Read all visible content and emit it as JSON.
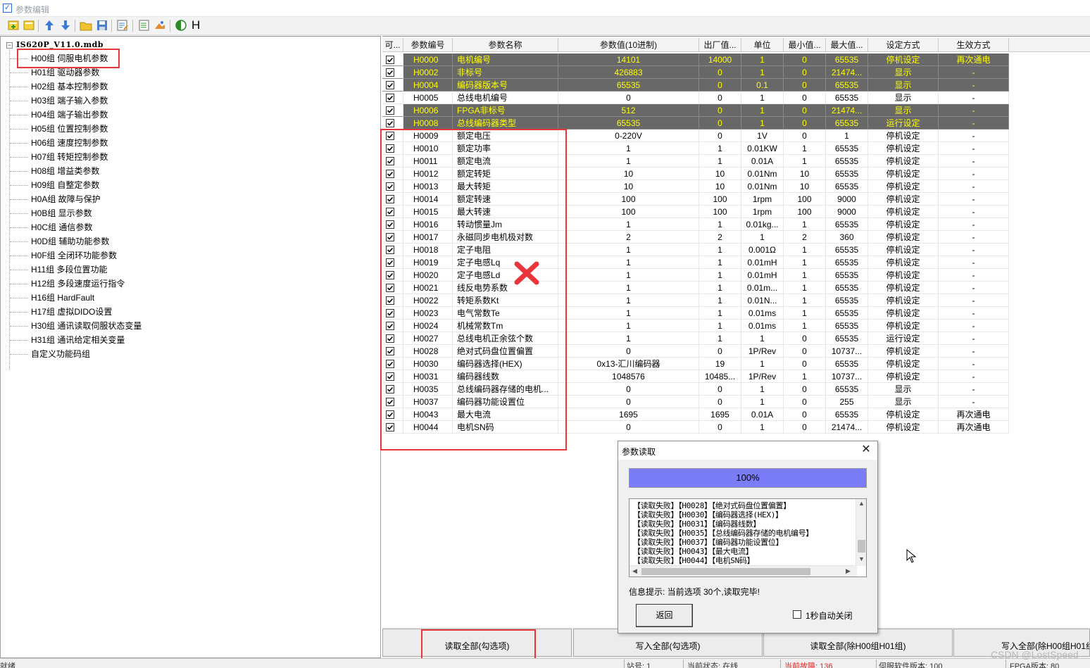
{
  "window": {
    "title": "参数编辑"
  },
  "toolbar": {
    "h_label": "H"
  },
  "tree": {
    "root": "IS620P_V11.0.mdb",
    "items": [
      "H00组 伺服电机参数",
      "H01组 驱动器参数",
      "H02组 基本控制参数",
      "H03组 端子输入参数",
      "H04组 端子输出参数",
      "H05组 位置控制参数",
      "H06组 速度控制参数",
      "H07组 转矩控制参数",
      "H08组 增益类参数",
      "H09组 自整定参数",
      "H0A组 故障与保护",
      "H0B组 显示参数",
      "H0C组 通信参数",
      "H0D组 辅助功能参数",
      "H0F组 全闭环功能参数",
      "H11组 多段位置功能",
      "H12组 多段速度运行指令",
      "H16组 HardFault",
      "H17组 虚拟DIDO设置",
      "H30组 通讯读取伺服状态变量",
      "H31组 通讯给定相关变量",
      "自定义功能码组"
    ]
  },
  "grid": {
    "headers": [
      "可...",
      "参数编号",
      "参数名称",
      "参数值(10进制)",
      "出厂值...",
      "单位",
      "最小值...",
      "最大值...",
      "设定方式",
      "生效方式"
    ],
    "rows": [
      {
        "checked": true,
        "dark": true,
        "cells": [
          "H0000",
          "电机编号",
          "14101",
          "14000",
          "1",
          "0",
          "65535",
          "停机设定",
          "再次通电"
        ]
      },
      {
        "checked": true,
        "dark": true,
        "cells": [
          "H0002",
          "非标号",
          "426883",
          "0",
          "1",
          "0",
          "21474...",
          "显示",
          "-"
        ]
      },
      {
        "checked": true,
        "dark": true,
        "cells": [
          "H0004",
          "编码器版本号",
          "65535",
          "0",
          "0.1",
          "0",
          "65535",
          "显示",
          "-"
        ]
      },
      {
        "checked": true,
        "dark": false,
        "cells": [
          "H0005",
          "总线电机编号",
          "0",
          "0",
          "1",
          "0",
          "65535",
          "显示",
          "-"
        ]
      },
      {
        "checked": true,
        "dark": true,
        "cells": [
          "H0006",
          "FPGA非标号",
          "512",
          "0",
          "1",
          "0",
          "21474...",
          "显示",
          "-"
        ]
      },
      {
        "checked": true,
        "dark": true,
        "cells": [
          "H0008",
          "总线编码器类型",
          "65535",
          "0",
          "1",
          "0",
          "65535",
          "运行设定",
          "-"
        ]
      },
      {
        "checked": true,
        "dark": false,
        "cells": [
          "H0009",
          "额定电压",
          "0-220V",
          "0",
          "1V",
          "0",
          "1",
          "停机设定",
          "-"
        ]
      },
      {
        "checked": true,
        "dark": false,
        "cells": [
          "H0010",
          "额定功率",
          "1",
          "1",
          "0.01KW",
          "1",
          "65535",
          "停机设定",
          "-"
        ]
      },
      {
        "checked": true,
        "dark": false,
        "cells": [
          "H0011",
          "额定电流",
          "1",
          "1",
          "0.01A",
          "1",
          "65535",
          "停机设定",
          "-"
        ]
      },
      {
        "checked": true,
        "dark": false,
        "cells": [
          "H0012",
          "额定转矩",
          "10",
          "10",
          "0.01Nm",
          "10",
          "65535",
          "停机设定",
          "-"
        ]
      },
      {
        "checked": true,
        "dark": false,
        "cells": [
          "H0013",
          "最大转矩",
          "10",
          "10",
          "0.01Nm",
          "10",
          "65535",
          "停机设定",
          "-"
        ]
      },
      {
        "checked": true,
        "dark": false,
        "cells": [
          "H0014",
          "额定转速",
          "100",
          "100",
          "1rpm",
          "100",
          "9000",
          "停机设定",
          "-"
        ]
      },
      {
        "checked": true,
        "dark": false,
        "cells": [
          "H0015",
          "最大转速",
          "100",
          "100",
          "1rpm",
          "100",
          "9000",
          "停机设定",
          "-"
        ]
      },
      {
        "checked": true,
        "dark": false,
        "cells": [
          "H0016",
          "转动惯量Jm",
          "1",
          "1",
          "0.01kg...",
          "1",
          "65535",
          "停机设定",
          "-"
        ]
      },
      {
        "checked": true,
        "dark": false,
        "cells": [
          "H0017",
          "永磁同步电机极对数",
          "2",
          "2",
          "1",
          "2",
          "360",
          "停机设定",
          "-"
        ]
      },
      {
        "checked": true,
        "dark": false,
        "cells": [
          "H0018",
          "定子电阻",
          "1",
          "1",
          "0.001Ω",
          "1",
          "65535",
          "停机设定",
          "-"
        ]
      },
      {
        "checked": true,
        "dark": false,
        "cells": [
          "H0019",
          "定子电感Lq",
          "1",
          "1",
          "0.01mH",
          "1",
          "65535",
          "停机设定",
          "-"
        ]
      },
      {
        "checked": true,
        "dark": false,
        "cells": [
          "H0020",
          "定子电感Ld",
          "1",
          "1",
          "0.01mH",
          "1",
          "65535",
          "停机设定",
          "-"
        ]
      },
      {
        "checked": true,
        "dark": false,
        "cells": [
          "H0021",
          "线反电势系数",
          "1",
          "1",
          "0.01m...",
          "1",
          "65535",
          "停机设定",
          "-"
        ]
      },
      {
        "checked": true,
        "dark": false,
        "cells": [
          "H0022",
          "转矩系数Kt",
          "1",
          "1",
          "0.01N...",
          "1",
          "65535",
          "停机设定",
          "-"
        ]
      },
      {
        "checked": true,
        "dark": false,
        "cells": [
          "H0023",
          "电气常数Te",
          "1",
          "1",
          "0.01ms",
          "1",
          "65535",
          "停机设定",
          "-"
        ]
      },
      {
        "checked": true,
        "dark": false,
        "cells": [
          "H0024",
          "机械常数Tm",
          "1",
          "1",
          "0.01ms",
          "1",
          "65535",
          "停机设定",
          "-"
        ]
      },
      {
        "checked": true,
        "dark": false,
        "cells": [
          "H0027",
          "总线电机正余弦个数",
          "1",
          "1",
          "1",
          "0",
          "65535",
          "运行设定",
          "-"
        ]
      },
      {
        "checked": true,
        "dark": false,
        "cells": [
          "H0028",
          "绝对式码盘位置偏置",
          "0",
          "0",
          "1P/Rev",
          "0",
          "10737...",
          "停机设定",
          "-"
        ]
      },
      {
        "checked": true,
        "dark": false,
        "cells": [
          "H0030",
          "编码器选择(HEX)",
          "0x13-汇川编码器",
          "19",
          "1",
          "0",
          "65535",
          "停机设定",
          "-"
        ]
      },
      {
        "checked": true,
        "dark": false,
        "cells": [
          "H0031",
          "编码器线数",
          "1048576",
          "10485...",
          "1P/Rev",
          "1",
          "10737...",
          "停机设定",
          "-"
        ]
      },
      {
        "checked": true,
        "dark": false,
        "cells": [
          "H0035",
          "总线编码器存储的电机...",
          "0",
          "0",
          "1",
          "0",
          "65535",
          "显示",
          "-"
        ]
      },
      {
        "checked": true,
        "dark": false,
        "cells": [
          "H0037",
          "编码器功能设置位",
          "0",
          "0",
          "1",
          "0",
          "255",
          "显示",
          "-"
        ]
      },
      {
        "checked": true,
        "dark": false,
        "cells": [
          "H0043",
          "最大电流",
          "1695",
          "1695",
          "0.01A",
          "0",
          "65535",
          "停机设定",
          "再次通电"
        ]
      },
      {
        "checked": true,
        "dark": false,
        "cells": [
          "H0044",
          "电机SN码",
          "0",
          "0",
          "1",
          "0",
          "21474...",
          "停机设定",
          "再次通电"
        ]
      }
    ]
  },
  "buttons": {
    "read_all_checked": "读取全部(勾选项)",
    "write_all_checked": "写入全部(勾选项)",
    "read_all_except": "读取全部(除H00组H01组)",
    "write_all_except": "写入全部(除H00组H01组"
  },
  "statusbar": {
    "ready": "就绪",
    "station": "站号: 1",
    "state": "当前状态: 在线",
    "fault": "当前故障: 136",
    "servo_version": "伺服软件版本: 100",
    "fpga_version": "FPGA版本: 80",
    "watermark": "CSDN @LostSpeed"
  },
  "dialog": {
    "title": "参数读取",
    "progress": "100%",
    "progress_fraction": 1.0,
    "log": [
      "【读取失败】【H0028】【绝对式码盘位置偏置】",
      "【读取失败】【H0030】【编码器选择(HEX)】",
      "【读取失败】【H0031】【编码器线数】",
      "【读取失败】【H0035】【总线编码器存储的电机编号】",
      "【读取失败】【H0037】【编码器功能设置位】",
      "【读取失败】【H0043】【最大电流】",
      "【读取失败】【H0044】【电机SN码】"
    ],
    "info": "信息提示: 当前选项 30个,读取完毕!",
    "return_button": "返回",
    "auto_close_label": "1秒自动关闭",
    "auto_close_checked": false
  },
  "colors": {
    "dark_row_bg": "#686868",
    "dark_row_text": "#ffff00",
    "highlight_red": "#e8363a",
    "progress_fill": "#7b7cf8"
  }
}
